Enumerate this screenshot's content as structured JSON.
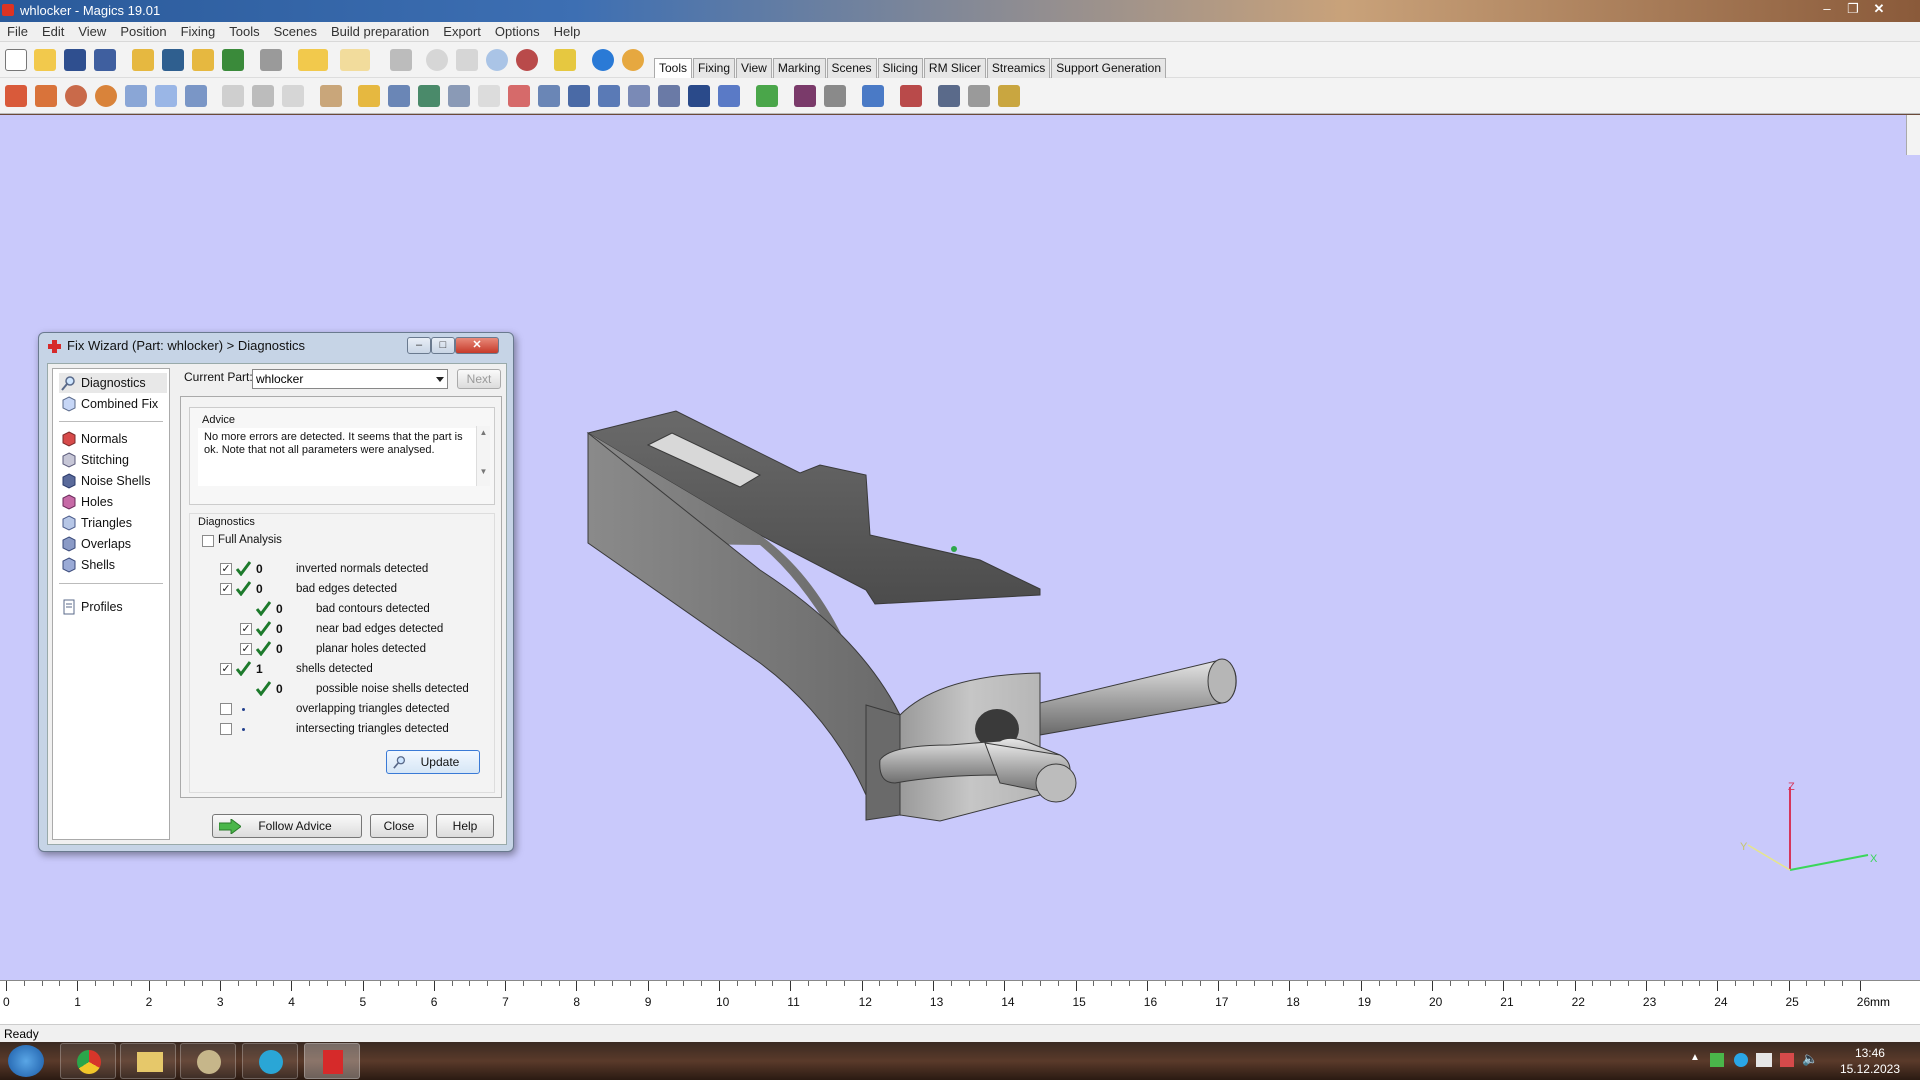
{
  "app": {
    "title": "whlocker - Magics 19.01"
  },
  "menu": [
    "File",
    "Edit",
    "View",
    "Position",
    "Fixing",
    "Tools",
    "Scenes",
    "Build preparation",
    "Export",
    "Options",
    "Help"
  ],
  "toolbar_tabs": [
    "Tools",
    "Fixing",
    "View",
    "Marking",
    "Scenes",
    "Slicing",
    "RM Slicer",
    "Streamics",
    "Support Generation"
  ],
  "dialog": {
    "title": "Fix Wizard (Part: whlocker) > Diagnostics",
    "nav": {
      "top": [
        "Diagnostics",
        "Combined Fix"
      ],
      "fixes": [
        "Normals",
        "Stitching",
        "Noise Shells",
        "Holes",
        "Triangles",
        "Overlaps",
        "Shells"
      ],
      "bottom": [
        "Profiles"
      ]
    },
    "current_part_label": "Current Part:",
    "current_part_value": "whlocker",
    "next_button": "Next",
    "advice_label": "Advice",
    "advice_text": "No more errors are detected. It seems that the part is ok. Note that not all parameters were analysed.",
    "diagnostics_label": "Diagnostics",
    "full_analysis_label": "Full Analysis",
    "rows": [
      {
        "checked": true,
        "status": "ok",
        "count": "0",
        "label": "inverted normals detected",
        "indent": 0
      },
      {
        "checked": true,
        "status": "ok",
        "count": "0",
        "label": "bad edges detected",
        "indent": 0
      },
      {
        "checked": null,
        "status": "ok",
        "count": "0",
        "label": "bad contours detected",
        "indent": 1
      },
      {
        "checked": true,
        "status": "ok",
        "count": "0",
        "label": "near bad edges detected",
        "indent": 1
      },
      {
        "checked": true,
        "status": "ok",
        "count": "0",
        "label": "planar holes detected",
        "indent": 1
      },
      {
        "checked": true,
        "status": "ok",
        "count": "1",
        "label": "shells detected",
        "indent": 0
      },
      {
        "checked": null,
        "status": "ok",
        "count": "0",
        "label": "possible noise shells detected",
        "indent": 1
      },
      {
        "checked": false,
        "status": "pending",
        "count": "",
        "label": "overlapping triangles detected",
        "indent": 0
      },
      {
        "checked": false,
        "status": "pending",
        "count": "",
        "label": "intersecting triangles detected",
        "indent": 0
      }
    ],
    "update_button": "Update",
    "follow_advice_button": "Follow Advice",
    "close_button": "Close",
    "help_button": "Help"
  },
  "ruler": {
    "ticks": [
      "0",
      "1",
      "2",
      "3",
      "4",
      "5",
      "6",
      "7",
      "8",
      "9",
      "10",
      "11",
      "12",
      "13",
      "14",
      "15",
      "16",
      "17",
      "18",
      "19",
      "20",
      "21",
      "22",
      "23",
      "24",
      "25",
      "26"
    ],
    "unit": "mm"
  },
  "axes": {
    "z": "Z",
    "x": "X",
    "y": "Y"
  },
  "status": "Ready",
  "taskbar": {
    "time": "13:46",
    "date": "15.12.2023"
  },
  "colors": {
    "viewport": "#c9c9fb",
    "check": "#1d7a2c",
    "model": "#8a8a8a"
  }
}
